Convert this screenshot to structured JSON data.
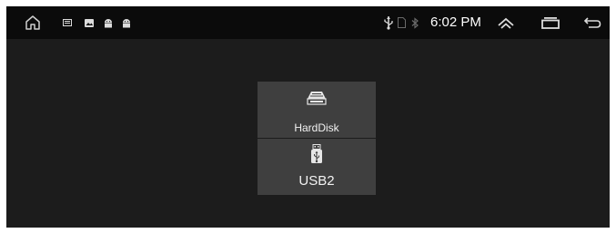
{
  "status_bar": {
    "time": "6:02 PM",
    "icons_left": [
      "home-icon",
      "app-notification-icon",
      "image-notification-icon",
      "android-notification-icon",
      "android-notification-icon"
    ],
    "icons_right": [
      "usb-icon",
      "sim-card-icon",
      "bluetooth-icon"
    ],
    "nav_buttons": [
      "expand-up-icon",
      "recent-apps-icon",
      "back-icon"
    ]
  },
  "storage": {
    "items": [
      {
        "label": "HardDisk",
        "icon": "hard-disk-icon"
      },
      {
        "label": "USB2",
        "icon": "usb-drive-icon"
      }
    ]
  },
  "colors": {
    "background": "#1c1c1c",
    "status_bar": "#0b0b0b",
    "card": "#3f3f3f",
    "text": "#ffffff"
  }
}
